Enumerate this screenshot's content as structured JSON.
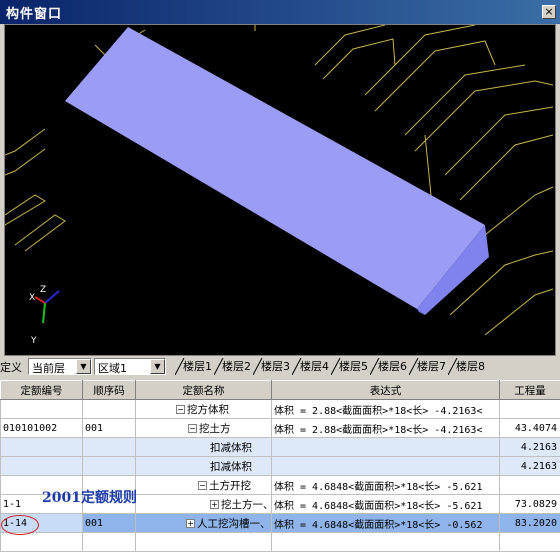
{
  "window": {
    "title": "构件窗口",
    "close_glyph": "×"
  },
  "axis": {
    "x": "X",
    "y": "Y",
    "z": "Z"
  },
  "toolbar": {
    "def_label": "定义",
    "floor_combo": "当前层",
    "area_combo": "区域1",
    "floor_tabs": [
      "楼层1",
      "楼层2",
      "楼层3",
      "楼层4",
      "楼层5",
      "楼层6",
      "楼层7",
      "楼层8"
    ]
  },
  "grid": {
    "headers": [
      "定额编号",
      "顺序码",
      "定额名称",
      "表达式",
      "工程量"
    ],
    "rows": [
      {
        "code": "",
        "order": "",
        "name": "挖方体积",
        "toggle": "−",
        "expr": "体积 = 2.88<截面面积>*18<长> -4.2163<",
        "qty": ""
      },
      {
        "code": "010101002",
        "order": "001",
        "name": "挖土方",
        "toggle": "−",
        "expr": "体积 = 2.88<截面面积>*18<长> -4.2163<",
        "qty": "43.4074"
      },
      {
        "code": "",
        "order": "",
        "name": "扣减体积",
        "toggle": "",
        "expr": "",
        "qty": "4.2163"
      },
      {
        "code": "",
        "order": "",
        "name": "扣减体积",
        "toggle": "",
        "expr": "",
        "qty": "4.2163"
      },
      {
        "code": "",
        "order": "",
        "name": "土方开挖",
        "toggle": "−",
        "expr": "体积 = 4.6848<截面面积>*18<长> -5.621",
        "qty": ""
      },
      {
        "code": "1-1",
        "order": "",
        "name": "挖土方一、二类土",
        "toggle": "+",
        "expr": "体积 = 4.6848<截面面积>*18<长> -5.621",
        "qty": "73.0829"
      },
      {
        "code": "1-14",
        "order": "001",
        "name": "人工挖沟槽一、二类土",
        "toggle": "+",
        "expr": "体积 = 4.6848<截面面积>*18<长> -0.562",
        "qty": "83.2020"
      },
      {
        "code": "",
        "order": "",
        "name": "",
        "toggle": "",
        "expr": "",
        "qty": ""
      }
    ]
  },
  "annotation": "2001定额规则",
  "colors": {
    "box_top": "#9a9cf5",
    "box_side": "#7c7ef0",
    "box_end": "#8c8ef4",
    "line": "#c9b44a",
    "titlebar": "#0a246a"
  }
}
